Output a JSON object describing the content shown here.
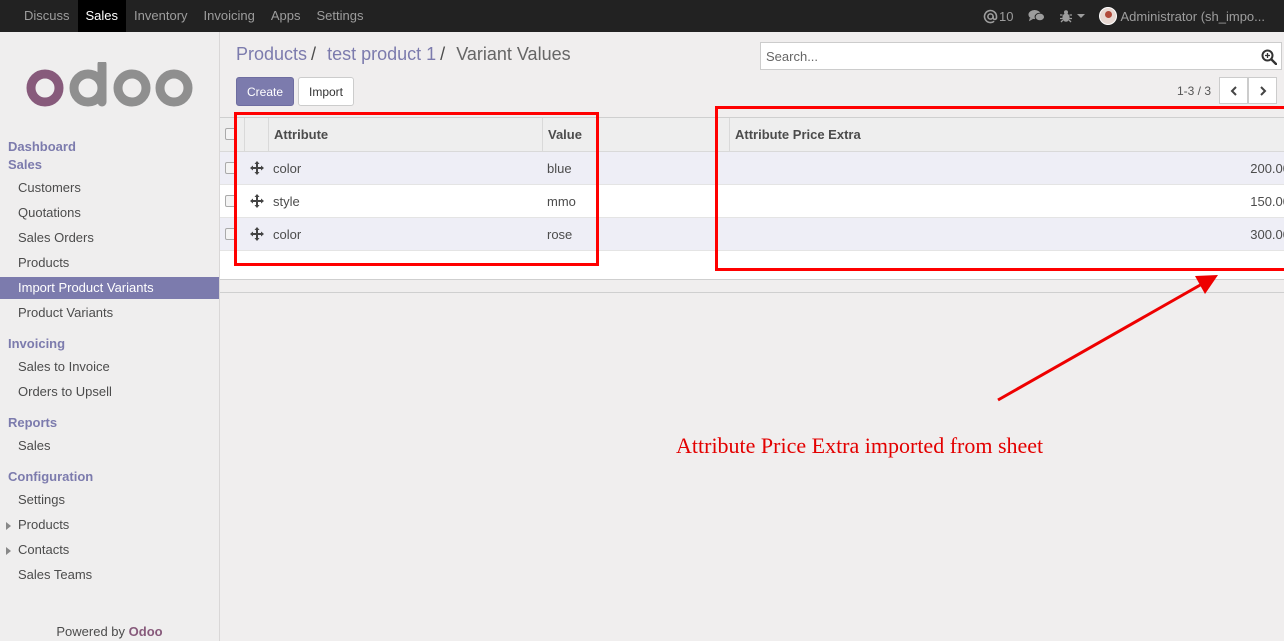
{
  "topbar": {
    "menu": [
      {
        "label": "Discuss",
        "active": false
      },
      {
        "label": "Sales",
        "active": true
      },
      {
        "label": "Inventory",
        "active": false
      },
      {
        "label": "Invoicing",
        "active": false
      },
      {
        "label": "Apps",
        "active": false
      },
      {
        "label": "Settings",
        "active": false
      }
    ],
    "mentions_count": "10",
    "user_label": "Administrator (sh_impo..."
  },
  "sidebar": {
    "sections": [
      {
        "label": "Dashboard"
      },
      {
        "label": "Sales"
      },
      {
        "label": "Invoicing"
      },
      {
        "label": "Reports"
      },
      {
        "label": "Configuration"
      }
    ],
    "items": [
      {
        "label": "Customers"
      },
      {
        "label": "Quotations"
      },
      {
        "label": "Sales Orders"
      },
      {
        "label": "Products"
      },
      {
        "label": "Import Product Variants",
        "active": true
      },
      {
        "label": "Product Variants"
      },
      {
        "label": "Sales to Invoice"
      },
      {
        "label": "Orders to Upsell"
      },
      {
        "label": "Sales"
      },
      {
        "label": "Settings"
      },
      {
        "label": "Products",
        "collapsible": true
      },
      {
        "label": "Contacts",
        "collapsible": true
      },
      {
        "label": "Sales Teams"
      }
    ],
    "powered_by": "Powered by",
    "powered_brand": "Odoo"
  },
  "breadcrumb": {
    "items": [
      "Products",
      "test product 1"
    ],
    "separator": "/",
    "current": "Variant Values"
  },
  "buttons": {
    "create": "Create",
    "import": "Import"
  },
  "search": {
    "placeholder": "Search..."
  },
  "pager": {
    "label": "1-3 / 3"
  },
  "table": {
    "columns": [
      "Attribute",
      "Value",
      "Attribute Price Extra"
    ],
    "rows": [
      {
        "attribute": "color",
        "value": "blue",
        "price_extra": "200.00"
      },
      {
        "attribute": "style",
        "value": "mmo",
        "price_extra": "150.00"
      },
      {
        "attribute": "color",
        "value": "rose",
        "price_extra": "300.00"
      }
    ]
  },
  "annotation": {
    "text": "Attribute Price Extra imported from sheet",
    "color": "#ff0000"
  },
  "colors": {
    "brand": "#875a7b",
    "accent": "#7c7bad",
    "topbar": "#222222"
  }
}
